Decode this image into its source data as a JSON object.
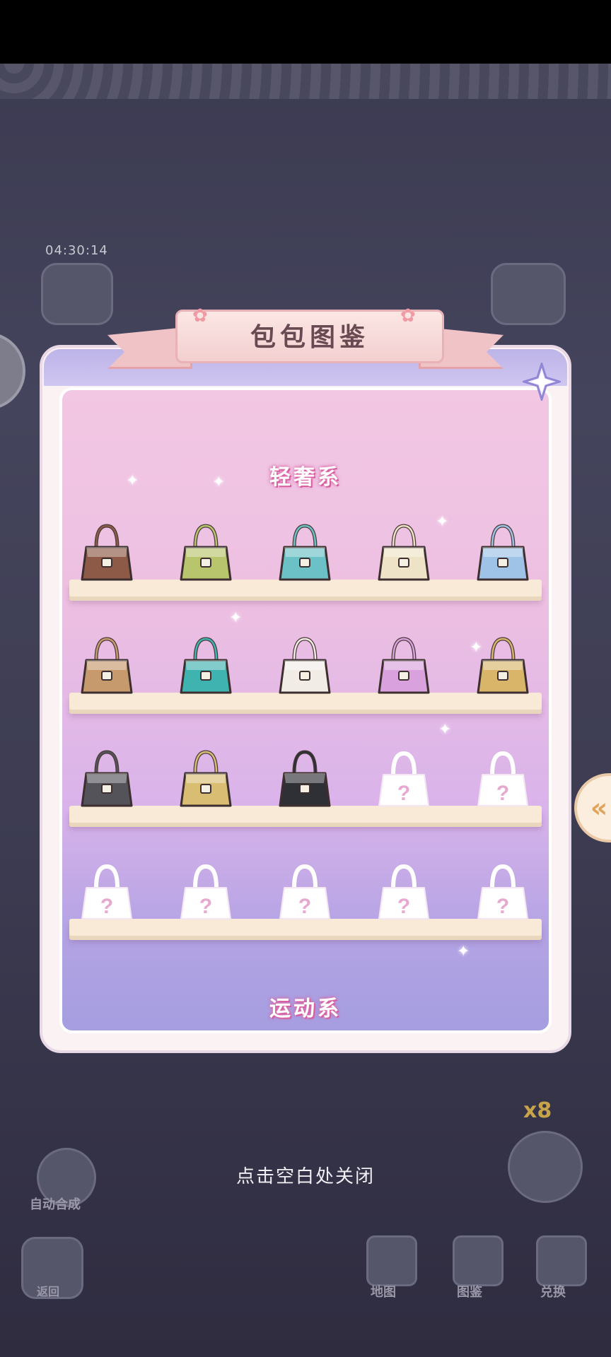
{
  "panel": {
    "title": "包包图鉴",
    "close_icon": "close-star-icon",
    "sections": [
      {
        "title": "轻奢系"
      },
      {
        "title": "运动系"
      }
    ],
    "shelves": [
      {
        "bags": [
          {
            "name": "brown-monogram-hobo",
            "unlocked": true,
            "color": "#8c5a46"
          },
          {
            "name": "green-satchel",
            "unlocked": true,
            "color": "#b8c56d"
          },
          {
            "name": "teal-scarf-tote",
            "unlocked": true,
            "color": "#6cc1c6"
          },
          {
            "name": "cream-flap-bag",
            "unlocked": true,
            "color": "#efe3c7"
          },
          {
            "name": "blue-plaid-tote",
            "unlocked": true,
            "color": "#9ec3e6"
          }
        ]
      },
      {
        "bags": [
          {
            "name": "quilted-tan-tote",
            "unlocked": true,
            "color": "#c79a6e"
          },
          {
            "name": "teal-glitter-bag",
            "unlocked": true,
            "color": "#3fb3b0"
          },
          {
            "name": "white-brown-bag",
            "unlocked": true,
            "color": "#f1ece6"
          },
          {
            "name": "pink-bow-bag",
            "unlocked": true,
            "color": "#d9a2de"
          },
          {
            "name": "gold-glitter-tote",
            "unlocked": true,
            "color": "#d9b56a"
          }
        ]
      },
      {
        "bags": [
          {
            "name": "black-white-tote",
            "unlocked": true,
            "color": "#55535a"
          },
          {
            "name": "gold-croc-bag",
            "unlocked": true,
            "color": "#d9bd73"
          },
          {
            "name": "zebra-bowling-bag",
            "unlocked": true,
            "color": "#2f2f36"
          },
          {
            "name": "locked",
            "unlocked": false,
            "color": "#ffffff"
          },
          {
            "name": "locked",
            "unlocked": false,
            "color": "#ffffff"
          }
        ]
      },
      {
        "bags": [
          {
            "name": "locked",
            "unlocked": false,
            "color": "#ffffff"
          },
          {
            "name": "locked",
            "unlocked": false,
            "color": "#ffffff"
          },
          {
            "name": "locked",
            "unlocked": false,
            "color": "#ffffff"
          },
          {
            "name": "locked",
            "unlocked": false,
            "color": "#ffffff"
          },
          {
            "name": "locked",
            "unlocked": false,
            "color": "#ffffff"
          }
        ]
      }
    ],
    "locked_mark": "?"
  },
  "hint": "点击空白处关闭",
  "background": {
    "timer": "04:30:14",
    "multiplier": "x8",
    "auto_merge_label": "自动合成",
    "back_label": "返回",
    "nav": [
      {
        "label": "地图",
        "icon": "map-icon"
      },
      {
        "label": "图鉴",
        "icon": "book-icon"
      },
      {
        "label": "兑换",
        "icon": "shop-icon"
      }
    ],
    "side_arrow": "«"
  },
  "colors": {
    "accent": "#d45b9f",
    "panel_bg": "#fbf2f4",
    "shelf": "#f8ead6"
  }
}
